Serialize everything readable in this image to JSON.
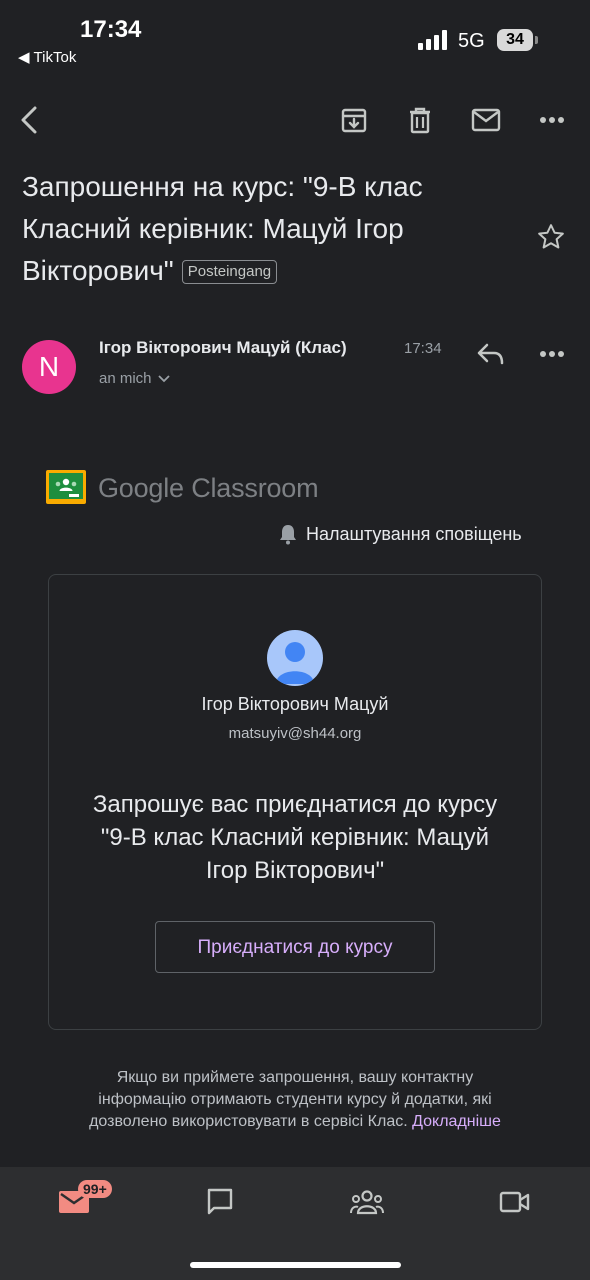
{
  "status_bar": {
    "time": "17:34",
    "back_app": "TikTok",
    "network": "5G",
    "battery": "34"
  },
  "toolbar": {
    "back_icon": "back-arrow-icon",
    "archive_icon": "archive-icon",
    "delete_icon": "trash-icon",
    "unread_icon": "mail-icon",
    "more_icon": "more-horiz-icon"
  },
  "email": {
    "subject": "Запрошення на курс: \"9-В клас Класний керівник: Мацуй Ігор Вікторович\"",
    "label": "Posteingang",
    "sender_initial": "N",
    "sender_name": "Ігор Вікторович Мацуй (Клас)",
    "time": "17:34",
    "recipient": "an mich"
  },
  "body": {
    "brand_google": "Google",
    "brand_product": "Classroom",
    "notifications_link": "Налаштування сповіщень",
    "teacher_name": "Ігор Вікторович Мацуй",
    "teacher_email": "matsuyiv@sh44.org",
    "invite_text": "Запрошує вас приєднатися до курсу \"9-В клас Класний керівник: Мацуй Ігор Вікторович\"",
    "join_button": "Приєднатися до курсу",
    "footer_text": "Якщо ви приймете запрошення, вашу контактну інформацію отримають студенти курсу й додатки, які дозволено використовувати в сервісі Клас. ",
    "learn_more": "Докладніше"
  },
  "bottom_nav": {
    "mail_badge": "99+"
  },
  "colors": {
    "background": "#202124",
    "avatar": "#e8348f",
    "accent": "#d7aefb",
    "badge": "#f28b82"
  }
}
